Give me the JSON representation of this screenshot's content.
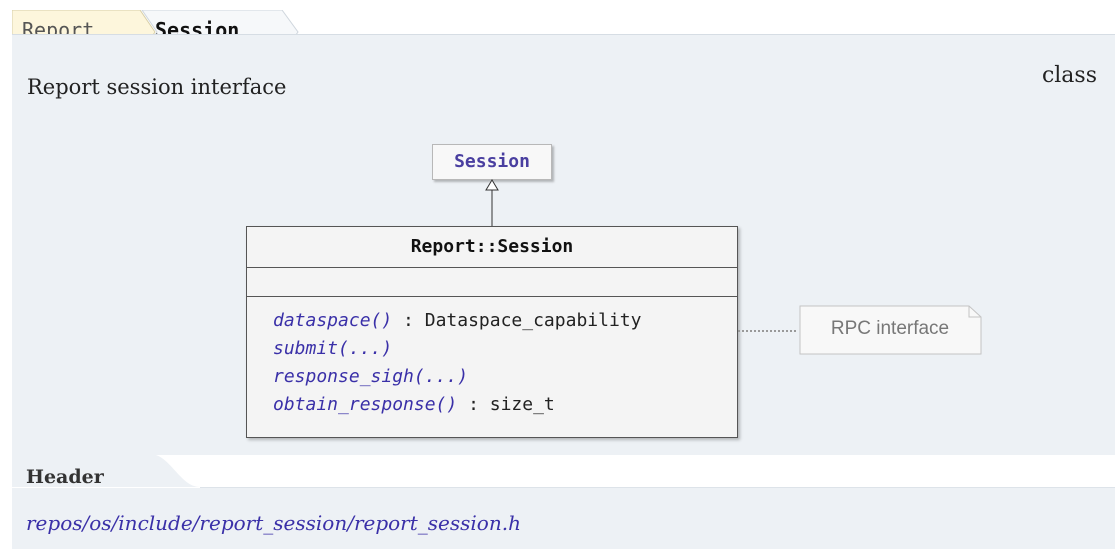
{
  "breadcrumb": {
    "items": [
      "Report",
      "Session"
    ]
  },
  "description": "Report session interface",
  "kind": "class",
  "diagram": {
    "base_class": "Session",
    "class_name": "Report::Session",
    "methods": [
      {
        "name": "dataspace()",
        "return": " : Dataspace_capability"
      },
      {
        "name": "submit(...)",
        "return": ""
      },
      {
        "name": "response_sigh(...)",
        "return": ""
      },
      {
        "name": "obtain_response()",
        "return": " : size_t"
      }
    ],
    "note": "RPC interface"
  },
  "header": {
    "title": "Header",
    "path": "repos/os/include/report_session/report_session.h"
  },
  "colors": {
    "panel": "#edf1f5",
    "crumb_first": "#fdf6dc",
    "link": "#3a30a8"
  }
}
